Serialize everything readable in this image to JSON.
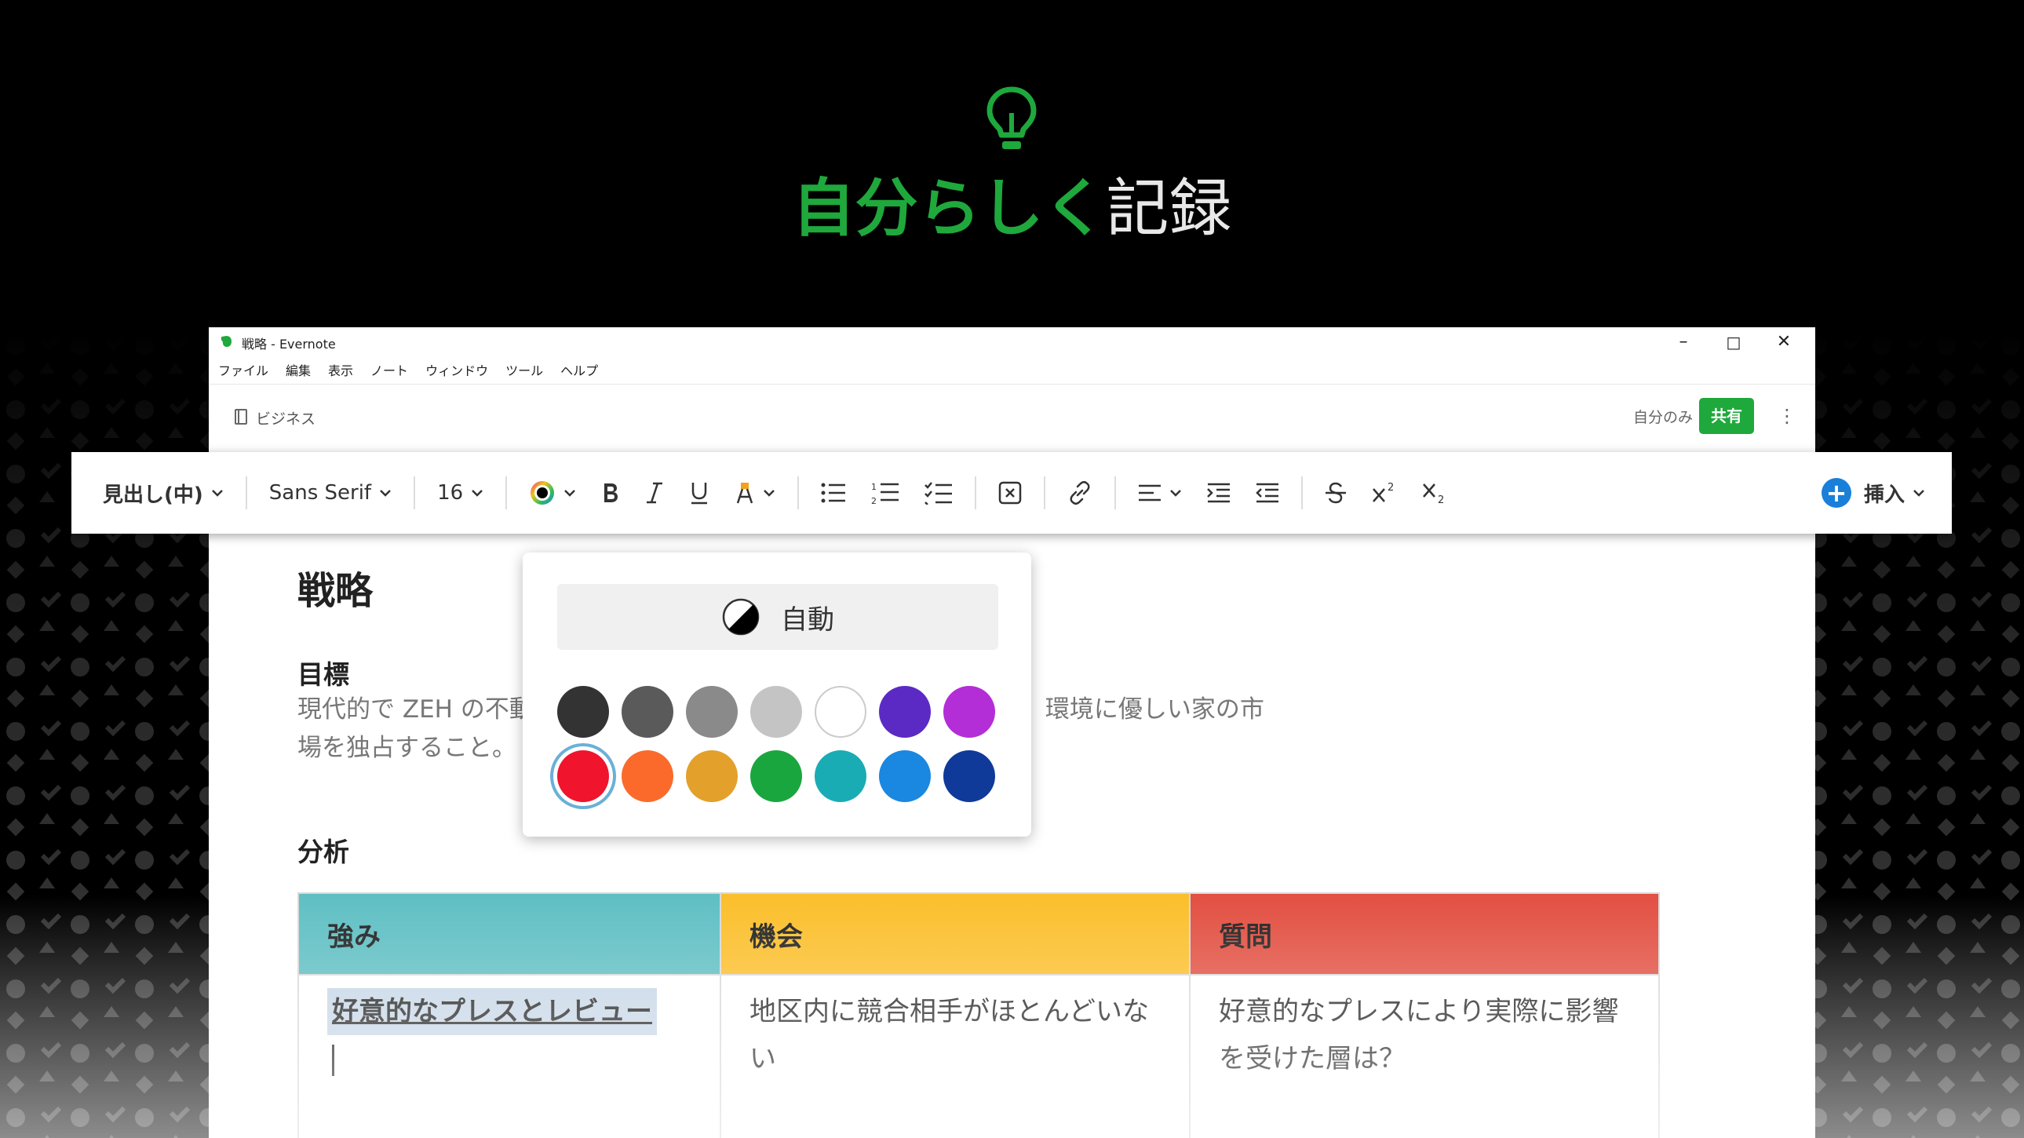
{
  "hero": {
    "title_green": "自分らしく",
    "title_white": "記録",
    "icon": "lightbulb-icon"
  },
  "window": {
    "title": "戦略 - Evernote",
    "controls": [
      "–",
      "□",
      "✕"
    ],
    "menu": [
      "ファイル",
      "編集",
      "表示",
      "ノート",
      "ウィンドウ",
      "ツール",
      "ヘルプ"
    ]
  },
  "notebook": {
    "name": "ビジネス",
    "share_scope": "自分のみ",
    "share_label": "共有"
  },
  "toolbar": {
    "paragraph_style": "見出し(中)",
    "font": "Sans Serif",
    "font_size": "16",
    "insert_label": "挿入"
  },
  "color_popup": {
    "auto_label": "自動",
    "colors": [
      "#333333",
      "#5a5a5a",
      "#8a8a8a",
      "#c4c4c4",
      "#ffffff",
      "#5b2ac5",
      "#b32ed6",
      "#f0142d",
      "#fb6a2b",
      "#e3a02a",
      "#1aa63e",
      "#1aacb4",
      "#1a87e0",
      "#0f3a9a"
    ],
    "selected_color": "#f0142d"
  },
  "note": {
    "title": "戦略",
    "goal_heading": "目標",
    "goal_line1_left": "現代的で ZEH の不動",
    "goal_line1_right": "環境に優しい家の市",
    "goal_line2": "場を独占すること。",
    "analysis_heading": "分析",
    "table": {
      "headers": [
        "強み",
        "機会",
        "質問"
      ],
      "header_colors": [
        "#5fbfc3",
        "#fbbf2c",
        "#e25042"
      ],
      "cells": [
        "好意的なプレスとレビュー",
        "地区内に競合相手がほとんどいない",
        "好意的なプレスにより実際に影響を受けた層は？"
      ]
    }
  },
  "colors": {
    "accent_green": "#1fa83c",
    "insert_blue": "#1a7fd9"
  }
}
